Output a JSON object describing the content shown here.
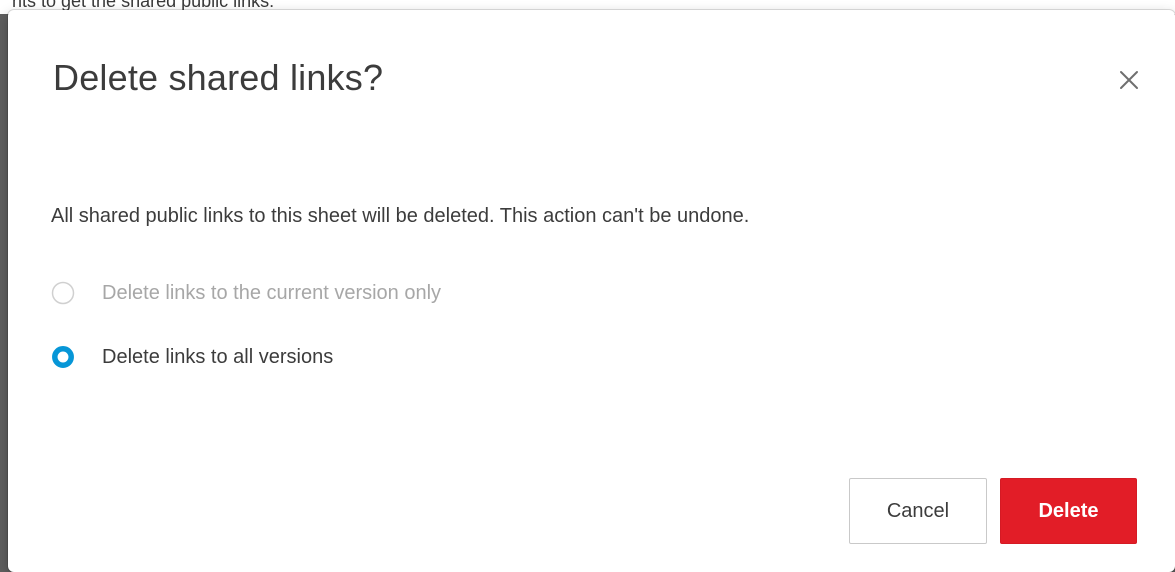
{
  "background_page": {
    "partial_text": "nts to get the shared public links:"
  },
  "dialog": {
    "title": "Delete shared links?",
    "close_icon": "close-icon",
    "message": "All shared public links to this sheet will be deleted. This action can't be undone.",
    "options": [
      {
        "label": "Delete links to the current version only",
        "selected": false,
        "disabled": true
      },
      {
        "label": "Delete links to all versions",
        "selected": true,
        "disabled": false
      }
    ],
    "buttons": {
      "cancel": "Cancel",
      "delete": "Delete"
    }
  },
  "colors": {
    "accent": "#0696d7",
    "danger": "#e21d27",
    "text": "#3c3c3c",
    "disabled_text": "#a7a7a7"
  }
}
